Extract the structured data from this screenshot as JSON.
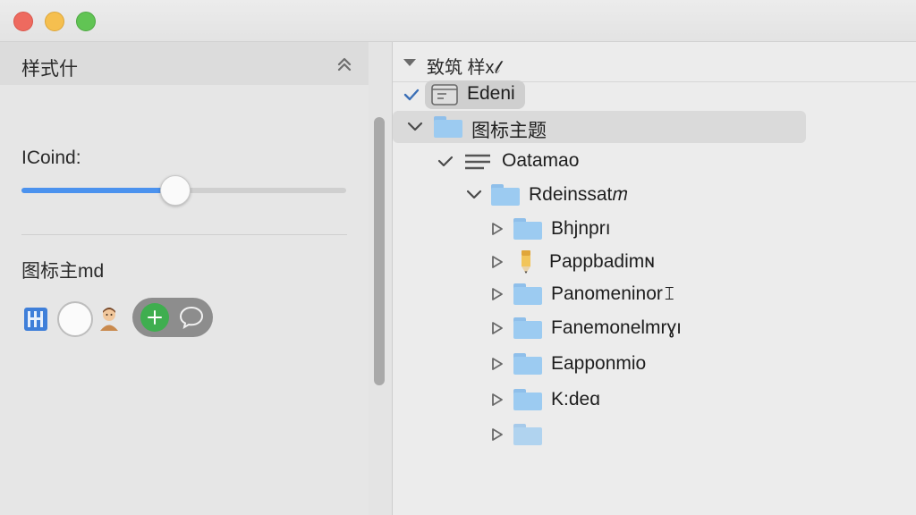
{
  "window": {
    "traffic_lights": [
      "close",
      "minimize",
      "zoom"
    ],
    "colors": {
      "close": "#ee6a5f",
      "minimize": "#f5bf4f",
      "zoom": "#61c454"
    }
  },
  "left_panel": {
    "header_title": "样式什",
    "collapse_icon": "chevron-up-double-icon",
    "slider": {
      "label": "ICoind:",
      "value_fraction": 0.47,
      "accent": "#4b92ee"
    },
    "section_label": "图标主md",
    "icon_row": [
      "grid-icon",
      "toggle-circle",
      "avatar-icon",
      "add-icon",
      "chat-icon"
    ]
  },
  "tree": {
    "header_label": "致筑 样x𝓁",
    "items": [
      {
        "label": "Edeni",
        "icon": "window-icon",
        "disclosure": "check",
        "selected": true
      },
      {
        "label": "图标主题",
        "icon": "folder-icon",
        "disclosure": "expanded"
      },
      {
        "label": "Oatamao",
        "icon": "list-icon",
        "disclosure": "check"
      },
      {
        "label": "Rdeinssat𝑚",
        "icon": "folder-icon",
        "disclosure": "expanded"
      },
      {
        "label": "Bhjnprı",
        "icon": "folder-icon",
        "disclosure": "collapsed"
      },
      {
        "label": "Pappbadimɴ",
        "icon": "pencil-icon",
        "disclosure": "collapsed"
      },
      {
        "label": "Panomeninor𝙸",
        "icon": "folder-icon",
        "disclosure": "collapsed"
      },
      {
        "label": "Fanemonelmrɣı",
        "icon": "folder-icon",
        "disclosure": "collapsed"
      },
      {
        "label": "Eapponmio",
        "icon": "folder-icon",
        "disclosure": "collapsed"
      },
      {
        "label": "K:deɑ",
        "icon": "folder-icon",
        "disclosure": "collapsed"
      },
      {
        "label": "",
        "icon": "folder-icon",
        "disclosure": "collapsed"
      }
    ]
  }
}
